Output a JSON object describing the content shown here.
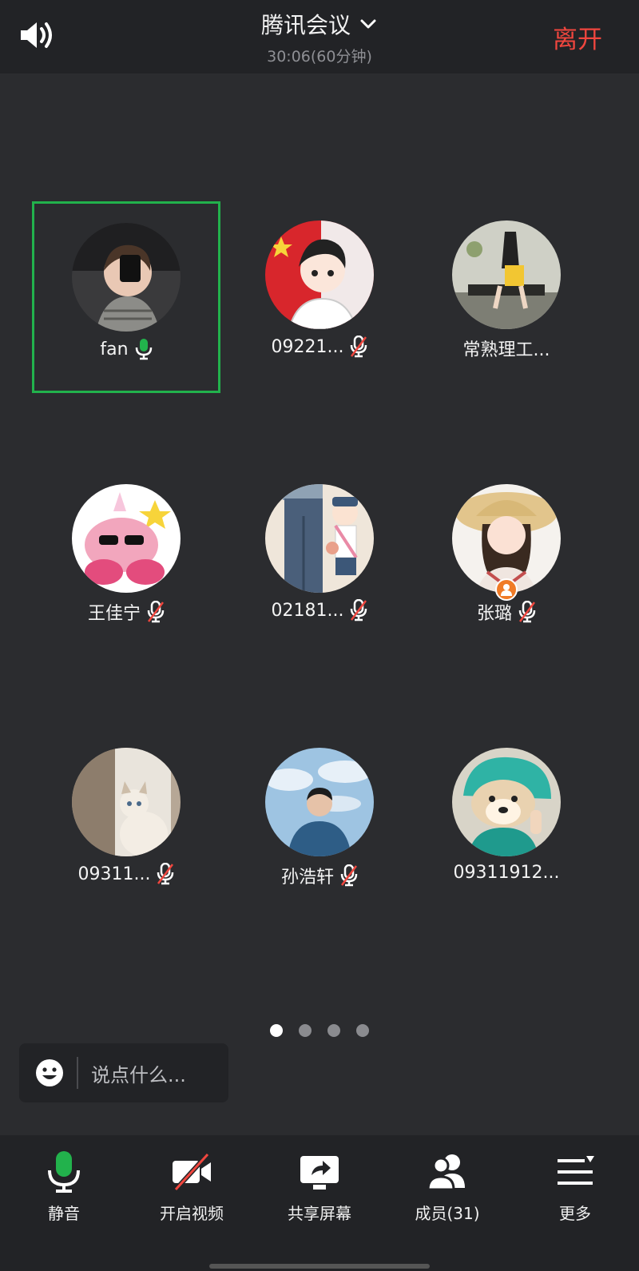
{
  "header": {
    "title": "腾讯会议",
    "duration": "30:06(60分钟)",
    "leave_label": "离开"
  },
  "participants": [
    {
      "name": "fan",
      "mic": "on",
      "active": true,
      "avatar_icon": "girl-photo-avatar"
    },
    {
      "name": "09221...",
      "mic": "muted",
      "avatar_icon": "anime-flag-avatar"
    },
    {
      "name": "常熟理工...",
      "mic": "none",
      "avatar_icon": "sitting-figure-avatar"
    },
    {
      "name": "王佳宁",
      "mic": "muted",
      "avatar_icon": "pink-cartoon-avatar"
    },
    {
      "name": "02181...",
      "mic": "muted",
      "avatar_icon": "anime-characters-avatar"
    },
    {
      "name": "张璐",
      "mic": "muted",
      "host": true,
      "avatar_icon": "sunhat-girl-avatar"
    },
    {
      "name": "09311...",
      "mic": "muted",
      "avatar_icon": "cat-avatar"
    },
    {
      "name": "孙浩轩",
      "mic": "muted",
      "avatar_icon": "sky-portrait-avatar"
    },
    {
      "name": "09311912...",
      "mic": "none",
      "avatar_icon": "dog-avatar"
    }
  ],
  "pager": {
    "total": 4,
    "current": 1
  },
  "chat": {
    "placeholder": "说点什么..."
  },
  "toolbar": {
    "mute_label": "静音",
    "video_label": "开启视频",
    "share_label": "共享屏幕",
    "members_label": "成员(31)",
    "more_label": "更多"
  },
  "colors": {
    "accent_green": "#22b24c",
    "leave_red": "#f0463e",
    "background": "#2b2c2f",
    "bar": "#222326",
    "host_orange": "#f07b27"
  }
}
